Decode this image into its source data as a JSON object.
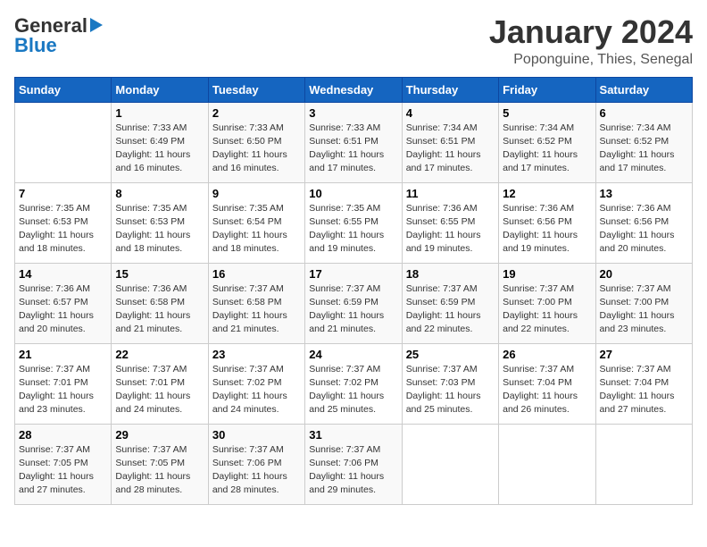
{
  "header": {
    "logo_general": "General",
    "logo_blue": "Blue",
    "month_title": "January 2024",
    "location": "Poponguine, Thies, Senegal"
  },
  "weekdays": [
    "Sunday",
    "Monday",
    "Tuesday",
    "Wednesday",
    "Thursday",
    "Friday",
    "Saturday"
  ],
  "weeks": [
    [
      {
        "day": "",
        "info": ""
      },
      {
        "day": "1",
        "info": "Sunrise: 7:33 AM\nSunset: 6:49 PM\nDaylight: 11 hours\nand 16 minutes."
      },
      {
        "day": "2",
        "info": "Sunrise: 7:33 AM\nSunset: 6:50 PM\nDaylight: 11 hours\nand 16 minutes."
      },
      {
        "day": "3",
        "info": "Sunrise: 7:33 AM\nSunset: 6:51 PM\nDaylight: 11 hours\nand 17 minutes."
      },
      {
        "day": "4",
        "info": "Sunrise: 7:34 AM\nSunset: 6:51 PM\nDaylight: 11 hours\nand 17 minutes."
      },
      {
        "day": "5",
        "info": "Sunrise: 7:34 AM\nSunset: 6:52 PM\nDaylight: 11 hours\nand 17 minutes."
      },
      {
        "day": "6",
        "info": "Sunrise: 7:34 AM\nSunset: 6:52 PM\nDaylight: 11 hours\nand 17 minutes."
      }
    ],
    [
      {
        "day": "7",
        "info": "Sunrise: 7:35 AM\nSunset: 6:53 PM\nDaylight: 11 hours\nand 18 minutes."
      },
      {
        "day": "8",
        "info": "Sunrise: 7:35 AM\nSunset: 6:53 PM\nDaylight: 11 hours\nand 18 minutes."
      },
      {
        "day": "9",
        "info": "Sunrise: 7:35 AM\nSunset: 6:54 PM\nDaylight: 11 hours\nand 18 minutes."
      },
      {
        "day": "10",
        "info": "Sunrise: 7:35 AM\nSunset: 6:55 PM\nDaylight: 11 hours\nand 19 minutes."
      },
      {
        "day": "11",
        "info": "Sunrise: 7:36 AM\nSunset: 6:55 PM\nDaylight: 11 hours\nand 19 minutes."
      },
      {
        "day": "12",
        "info": "Sunrise: 7:36 AM\nSunset: 6:56 PM\nDaylight: 11 hours\nand 19 minutes."
      },
      {
        "day": "13",
        "info": "Sunrise: 7:36 AM\nSunset: 6:56 PM\nDaylight: 11 hours\nand 20 minutes."
      }
    ],
    [
      {
        "day": "14",
        "info": "Sunrise: 7:36 AM\nSunset: 6:57 PM\nDaylight: 11 hours\nand 20 minutes."
      },
      {
        "day": "15",
        "info": "Sunrise: 7:36 AM\nSunset: 6:58 PM\nDaylight: 11 hours\nand 21 minutes."
      },
      {
        "day": "16",
        "info": "Sunrise: 7:37 AM\nSunset: 6:58 PM\nDaylight: 11 hours\nand 21 minutes."
      },
      {
        "day": "17",
        "info": "Sunrise: 7:37 AM\nSunset: 6:59 PM\nDaylight: 11 hours\nand 21 minutes."
      },
      {
        "day": "18",
        "info": "Sunrise: 7:37 AM\nSunset: 6:59 PM\nDaylight: 11 hours\nand 22 minutes."
      },
      {
        "day": "19",
        "info": "Sunrise: 7:37 AM\nSunset: 7:00 PM\nDaylight: 11 hours\nand 22 minutes."
      },
      {
        "day": "20",
        "info": "Sunrise: 7:37 AM\nSunset: 7:00 PM\nDaylight: 11 hours\nand 23 minutes."
      }
    ],
    [
      {
        "day": "21",
        "info": "Sunrise: 7:37 AM\nSunset: 7:01 PM\nDaylight: 11 hours\nand 23 minutes."
      },
      {
        "day": "22",
        "info": "Sunrise: 7:37 AM\nSunset: 7:01 PM\nDaylight: 11 hours\nand 24 minutes."
      },
      {
        "day": "23",
        "info": "Sunrise: 7:37 AM\nSunset: 7:02 PM\nDaylight: 11 hours\nand 24 minutes."
      },
      {
        "day": "24",
        "info": "Sunrise: 7:37 AM\nSunset: 7:02 PM\nDaylight: 11 hours\nand 25 minutes."
      },
      {
        "day": "25",
        "info": "Sunrise: 7:37 AM\nSunset: 7:03 PM\nDaylight: 11 hours\nand 25 minutes."
      },
      {
        "day": "26",
        "info": "Sunrise: 7:37 AM\nSunset: 7:04 PM\nDaylight: 11 hours\nand 26 minutes."
      },
      {
        "day": "27",
        "info": "Sunrise: 7:37 AM\nSunset: 7:04 PM\nDaylight: 11 hours\nand 27 minutes."
      }
    ],
    [
      {
        "day": "28",
        "info": "Sunrise: 7:37 AM\nSunset: 7:05 PM\nDaylight: 11 hours\nand 27 minutes."
      },
      {
        "day": "29",
        "info": "Sunrise: 7:37 AM\nSunset: 7:05 PM\nDaylight: 11 hours\nand 28 minutes."
      },
      {
        "day": "30",
        "info": "Sunrise: 7:37 AM\nSunset: 7:06 PM\nDaylight: 11 hours\nand 28 minutes."
      },
      {
        "day": "31",
        "info": "Sunrise: 7:37 AM\nSunset: 7:06 PM\nDaylight: 11 hours\nand 29 minutes."
      },
      {
        "day": "",
        "info": ""
      },
      {
        "day": "",
        "info": ""
      },
      {
        "day": "",
        "info": ""
      }
    ]
  ]
}
